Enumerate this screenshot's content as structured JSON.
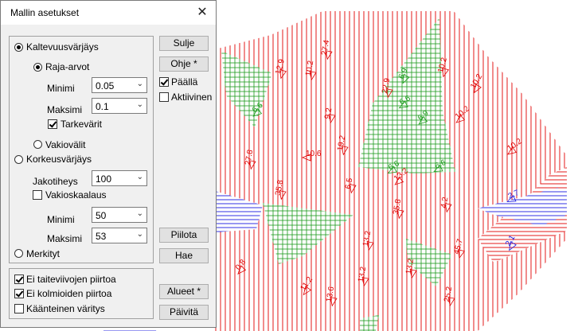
{
  "dialog": {
    "title": "Mallin asetukset",
    "slope": {
      "label": "Kaltevuusvärjäys",
      "selected": true,
      "raja": {
        "label": "Raja-arvot",
        "selected": true
      },
      "min_label": "Minimi",
      "min_value": "0.05",
      "max_label": "Maksimi",
      "max_value": "0.1",
      "tarkevarit": {
        "label": "Tarkevärit",
        "checked": true
      },
      "vakiovalit": {
        "label": "Vakiovälit",
        "selected": false
      }
    },
    "height": {
      "label": "Korkeusvärjäys",
      "selected": false,
      "jakotiheys_label": "Jakotiheys",
      "jakotiheys_value": "100",
      "vakioskaalaus": {
        "label": "Vakioskaalaus",
        "checked": false
      },
      "min_label": "Minimi",
      "min_value": "50",
      "max_label": "Maksimi",
      "max_value": "53"
    },
    "merkityt": {
      "label": "Merkityt",
      "selected": false
    },
    "options": {
      "ei_taiteviivojen": {
        "label": "Ei taiteviivojen piirtoa",
        "checked": true
      },
      "ei_kolmioiden": {
        "label": "Ei kolmioiden piirtoa",
        "checked": true
      },
      "kaanteinen": {
        "label": "Käänteinen väritys",
        "checked": false
      }
    },
    "buttons": {
      "sulje": "Sulje",
      "ohje": "Ohje *",
      "piilota": "Piilota",
      "hae": "Hae",
      "alueet": "Alueet *",
      "paivita": "Päivitä"
    },
    "paalla": {
      "label": "Päällä",
      "checked": true
    },
    "aktiivinen": {
      "label": "Aktiivinen",
      "checked": false
    }
  },
  "map": {
    "colors": {
      "red": "#e00000",
      "green": "#1a9a1a",
      "blue": "#1a1ae0"
    },
    "slope_labels": [
      {
        "text": "10.2",
        "color": "red"
      },
      {
        "text": "12.9",
        "color": "red"
      },
      {
        "text": "6.9",
        "color": "green"
      },
      {
        "text": "10.2",
        "color": "red"
      },
      {
        "text": "10.2",
        "color": "red"
      },
      {
        "text": "22.9",
        "color": "red"
      },
      {
        "text": "6.9",
        "color": "green"
      },
      {
        "text": "27.8",
        "color": "red"
      },
      {
        "text": "19.2",
        "color": "red"
      },
      {
        "text": "10.2",
        "color": "red"
      },
      {
        "text": "6.6",
        "color": "green"
      },
      {
        "text": "10.6",
        "color": "red"
      },
      {
        "text": "9.2",
        "color": "red"
      },
      {
        "text": "6.6",
        "color": "green"
      },
      {
        "text": "6.6",
        "color": "green"
      },
      {
        "text": "10.2",
        "color": "red"
      },
      {
        "text": "27.4",
        "color": "red"
      },
      {
        "text": "35.8",
        "color": "red"
      },
      {
        "text": "6.5",
        "color": "red"
      },
      {
        "text": "35.8",
        "color": "red"
      },
      {
        "text": "4.2",
        "color": "red"
      },
      {
        "text": "2.7",
        "color": "blue"
      },
      {
        "text": "2.1",
        "color": "blue"
      },
      {
        "text": "6.6",
        "color": "green"
      },
      {
        "text": "13.2",
        "color": "red"
      },
      {
        "text": "45.7",
        "color": "red"
      },
      {
        "text": "0.8",
        "color": "red"
      },
      {
        "text": "13.2",
        "color": "red"
      },
      {
        "text": "13.2",
        "color": "red"
      },
      {
        "text": "11.2",
        "color": "red"
      },
      {
        "text": "13.6",
        "color": "red"
      },
      {
        "text": "25.2",
        "color": "red"
      },
      {
        "text": "13.2",
        "color": "red"
      }
    ]
  }
}
